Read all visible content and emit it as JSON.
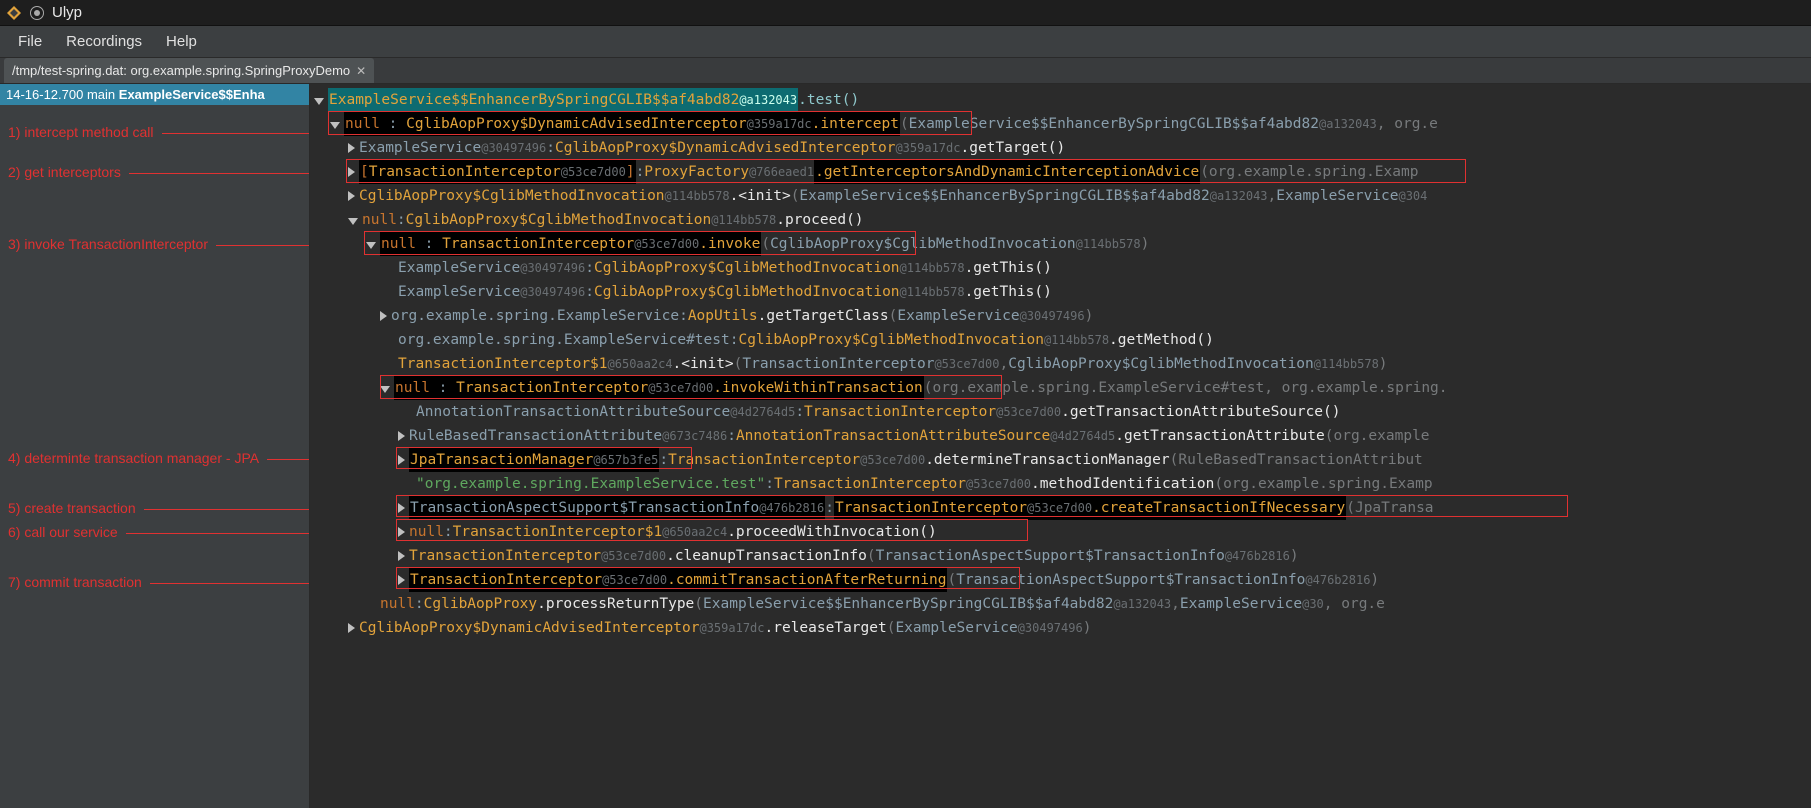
{
  "app": {
    "title": "Ulyp"
  },
  "menu": {
    "file": "File",
    "recordings": "Recordings",
    "help": "Help"
  },
  "tab": {
    "label": "/tmp/test-spring.dat: org.example.spring.SpringProxyDemo"
  },
  "left": {
    "timestamp": "14-16-12.700",
    "thread": "main",
    "method": "ExampleService$$Enha"
  },
  "annos": {
    "a1": "1) intercept method call",
    "a2": "2) get interceptors",
    "a3": "3) invoke TransactionInterceptor",
    "a4": "4) determinte transaction manager - JPA",
    "a5": "5) create transaction",
    "a6": "6) call our service",
    "a7": "7) commit transaction"
  },
  "rows": {
    "r0_cls": "ExampleService$$EnhancerBySpringCGLIB$$af4abd82",
    "r0_hash": "@a132043",
    "r0_meth": ".test()",
    "r1_ret": "null",
    "r1_cls": "CglibAopProxy$DynamicAdvisedInterceptor",
    "r1_hash": "@359a17dc",
    "r1_meth": ".intercept",
    "r1_arg1": "ExampleService$$EnhancerBySpringCGLIB$$af4abd82",
    "r1_arg1h": "@a132043",
    "r1_arg_tail": ", org.e",
    "r2_ret": "ExampleService",
    "r2_reth": "@30497496",
    "r2_cls": "CglibAopProxy$DynamicAdvisedInterceptor",
    "r2_h": "@359a17dc",
    "r2_meth": ".getTarget()",
    "r3_ret_open": "[",
    "r3_ret_cls": "TransactionInterceptor",
    "r3_ret_h": "@53ce7d00",
    "r3_ret_close": "]",
    "r3_cls": "ProxyFactory",
    "r3_h": "@766eaed1",
    "r3_meth": ".getInterceptorsAndDynamicInterceptionAdvice",
    "r3_arg": "(org.example.spring.Examp",
    "r4_ret": "CglibAopProxy$CglibMethodInvocation",
    "r4_reth": "@114bb578",
    "r4_meth": ".<init>",
    "r4_arg1": "ExampleService$$EnhancerBySpringCGLIB$$af4abd82",
    "r4_arg1h": "@a132043",
    "r4_arg2": "ExampleService",
    "r4_arg2h": "@304",
    "r5_ret": "null",
    "r5_cls": "CglibAopProxy$CglibMethodInvocation",
    "r5_h": "@114bb578",
    "r5_meth": ".proceed()",
    "r6_ret": "null",
    "r6_cls": "TransactionInterceptor",
    "r6_h": "@53ce7d00",
    "r6_meth": ".invoke",
    "r6_arg": "CglibAopProxy$CglibMethodInvocation",
    "r6_argh": "@114bb578",
    "r7_ret": "ExampleService",
    "r7_reth": "@30497496",
    "r7_cls": "CglibAopProxy$CglibMethodInvocation",
    "r7_h": "@114bb578",
    "r7_meth": ".getThis()",
    "r8_ret": "ExampleService",
    "r8_reth": "@30497496",
    "r8_cls": "CglibAopProxy$CglibMethodInvocation",
    "r8_h": "@114bb578",
    "r8_meth": ".getThis()",
    "r9_ret": "org.example.spring.ExampleService",
    "r9_cls": "AopUtils",
    "r9_meth": ".getTargetClass",
    "r9_arg": "ExampleService",
    "r9_argh": "@30497496",
    "r10_ret": "org.example.spring.ExampleService#test",
    "r10_cls": "CglibAopProxy$CglibMethodInvocation",
    "r10_h": "@114bb578",
    "r10_meth": ".getMethod()",
    "r11_ret": "TransactionInterceptor$1",
    "r11_reth": "@650aa2c4",
    "r11_meth": ".<init>",
    "r11_arg1": "TransactionInterceptor",
    "r11_arg1h": "@53ce7d00",
    "r11_arg2": "CglibAopProxy$CglibMethodInvocation",
    "r11_arg2h": "@114bb578",
    "r12_ret": "null",
    "r12_cls": "TransactionInterceptor",
    "r12_h": "@53ce7d00",
    "r12_meth": ".invokeWithinTransaction",
    "r12_arg": "(org.example.spring.ExampleService#test, org.example.spring.",
    "r13_ret": "AnnotationTransactionAttributeSource",
    "r13_reth": "@4d2764d5",
    "r13_cls": "TransactionInterceptor",
    "r13_h": "@53ce7d00",
    "r13_meth": ".getTransactionAttributeSource()",
    "r14_ret": "RuleBasedTransactionAttribute",
    "r14_reth": "@673c7486",
    "r14_cls": "AnnotationTransactionAttributeSource",
    "r14_h": "@4d2764d5",
    "r14_meth": ".getTransactionAttribute",
    "r14_arg": "(org.example",
    "r15_ret": "JpaTransactionManager",
    "r15_reth": "@657b3fe5",
    "r15_cls": "TransactionInterceptor",
    "r15_h": "@53ce7d00",
    "r15_meth": ".determineTransactionManager",
    "r15_arg": "(RuleBasedTransactionAttribut",
    "r16_ret": "\"org.example.spring.ExampleService.test\"",
    "r16_cls": "TransactionInterceptor",
    "r16_h": "@53ce7d00",
    "r16_meth": ".methodIdentification",
    "r16_arg": "(org.example.spring.Examp",
    "r17_ret": "TransactionAspectSupport$TransactionInfo",
    "r17_reth": "@476b2816",
    "r17_cls": "TransactionInterceptor",
    "r17_h": "@53ce7d00",
    "r17_meth": ".createTransactionIfNecessary",
    "r17_arg": "(JpaTransa",
    "r18_ret": "null",
    "r18_cls": "TransactionInterceptor$1",
    "r18_h": "@650aa2c4",
    "r18_meth": ".proceedWithInvocation()",
    "r19_cls": "TransactionInterceptor",
    "r19_h": "@53ce7d00",
    "r19_meth": ".cleanupTransactionInfo",
    "r19_arg": "TransactionAspectSupport$TransactionInfo",
    "r19_argh": "@476b2816",
    "r20_cls": "TransactionInterceptor",
    "r20_h": "@53ce7d00",
    "r20_meth": ".commitTransactionAfterReturning",
    "r20_arg": "TransactionAspectSupport$TransactionInfo",
    "r20_argh": "@476b2816",
    "r21_ret": "null",
    "r21_cls": "CglibAopProxy",
    "r21_meth": ".processReturnType",
    "r21_arg1": "ExampleService$$EnhancerBySpringCGLIB$$af4abd82",
    "r21_arg1h": "@a132043",
    "r21_arg2": "ExampleService",
    "r21_arg2h": "@30",
    "r21_tail": ", org.e",
    "r22_cls": "CglibAopProxy$DynamicAdvisedInterceptor",
    "r22_h": "@359a17dc",
    "r22_meth": ".releaseTarget",
    "r22_arg": "ExampleService",
    "r22_argh": "@30497496"
  }
}
